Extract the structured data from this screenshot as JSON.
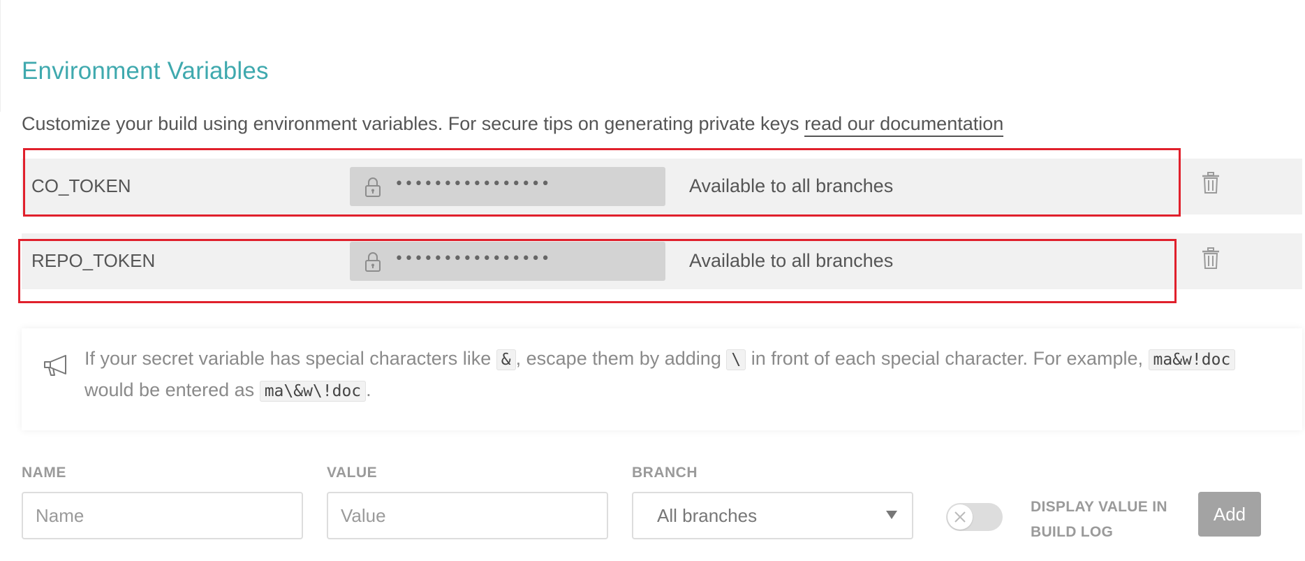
{
  "section": {
    "title": "Environment Variables",
    "intro_text": "Customize your build using environment variables. For secure tips on generating private keys",
    "intro_link": "read our documentation"
  },
  "variables": [
    {
      "name": "CO_TOKEN",
      "masked_value": "••••••••••••••••",
      "branch": "Available to all branches"
    },
    {
      "name": "REPO_TOKEN",
      "masked_value": "••••••••••••••••",
      "branch": "Available to all branches"
    }
  ],
  "notice": {
    "part1": "If your secret variable has special characters like",
    "code1": "&",
    "part2": ", escape them by adding",
    "code2": "\\",
    "part3": "in front of each special character. For example,",
    "code3": "ma&w!doc",
    "part4": "would be entered as",
    "code4": "ma\\&w\\!doc",
    "part5": "."
  },
  "form": {
    "name_label": "NAME",
    "name_placeholder": "Name",
    "value_label": "VALUE",
    "value_placeholder": "Value",
    "branch_label": "BRANCH",
    "branch_selected": "All branches",
    "display_value_label": "DISPLAY VALUE IN BUILD LOG",
    "display_value_enabled": false,
    "add_label": "Add"
  },
  "colors": {
    "title": "#3fa9ae",
    "highlight_border": "#e0202c",
    "row_background": "#f1f1f1",
    "masked_field": "#d3d3d3",
    "add_button": "#a3a3a3"
  },
  "icons": [
    "lock-icon",
    "trash-icon",
    "megaphone-icon",
    "chevron-down-icon",
    "close-icon"
  ]
}
